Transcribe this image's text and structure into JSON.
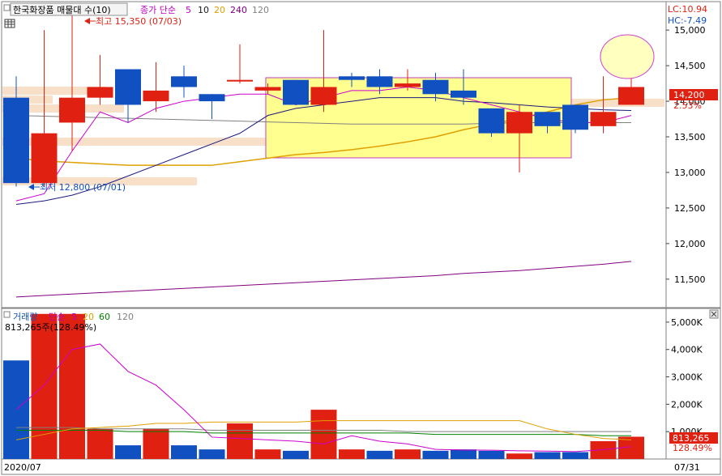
{
  "header": {
    "title": "한국화장품 매물대 수(10)",
    "ma_label": "종가 단순",
    "ma_periods": [
      "5",
      "10",
      "20",
      "240",
      "120"
    ],
    "ma_colors": [
      "#cc00cc",
      "#1a1a1a",
      "#e0a000",
      "#800080",
      "#808080"
    ],
    "lc_label": "LC:10.94",
    "hc_label": "HC:-7.49",
    "high_annot": "최고 15,350 (07/03)",
    "low_annot": "최저 12,800 (07/01)"
  },
  "volume_header": {
    "title": "거래량",
    "ma_label": "단순",
    "ma_periods": [
      "5",
      "20",
      "60",
      "120"
    ],
    "ma_colors": [
      "#cc00cc",
      "#e0a000",
      "#008000",
      "#808080"
    ],
    "readout": "813,265주(128.49%)"
  },
  "price_badge": {
    "value": "14,200",
    "pct": "2.53%"
  },
  "volume_badge": {
    "value": "813,265",
    "pct": "128.49%"
  },
  "x_axis": {
    "start_label": "2020/07",
    "end_label": "07/31"
  },
  "colors": {
    "up": "#e02010",
    "down": "#1050c0",
    "highlight": "#ffff90",
    "highlight_border": "#c040c0",
    "band": "#f8e0c8"
  },
  "chart_data": [
    {
      "type": "candlestick",
      "title": "한국화장품 매물대 수(10)",
      "ylim": [
        11100,
        15400
      ],
      "y_ticks": [
        11500,
        12000,
        12500,
        13000,
        13500,
        14000,
        14500,
        15000
      ],
      "y_tick_labels": [
        "11,500",
        "12,000",
        "12,500",
        "13,000",
        "13,500",
        "14,000",
        "14,500",
        "15,000"
      ],
      "candles": [
        {
          "o": 14050,
          "h": 14350,
          "l": 12800,
          "c": 12850
        },
        {
          "o": 12850,
          "h": 15000,
          "l": 12800,
          "c": 13550
        },
        {
          "o": 13700,
          "h": 15350,
          "l": 13300,
          "c": 14050
        },
        {
          "o": 14050,
          "h": 14650,
          "l": 13950,
          "c": 14200
        },
        {
          "o": 14450,
          "h": 14450,
          "l": 13700,
          "c": 13950
        },
        {
          "o": 14000,
          "h": 14550,
          "l": 13850,
          "c": 14150
        },
        {
          "o": 14350,
          "h": 14500,
          "l": 14050,
          "c": 14200
        },
        {
          "o": 14100,
          "h": 14100,
          "l": 13750,
          "c": 14000
        },
        {
          "o": 14300,
          "h": 14800,
          "l": 14250,
          "c": 14300
        },
        {
          "o": 14150,
          "h": 14250,
          "l": 14100,
          "c": 14200
        },
        {
          "o": 14300,
          "h": 14300,
          "l": 13950,
          "c": 13950
        },
        {
          "o": 13950,
          "h": 15000,
          "l": 13850,
          "c": 14200
        },
        {
          "o": 14350,
          "h": 14400,
          "l": 14200,
          "c": 14300
        },
        {
          "o": 14350,
          "h": 14450,
          "l": 14100,
          "c": 14200
        },
        {
          "o": 14200,
          "h": 14450,
          "l": 14150,
          "c": 14250
        },
        {
          "o": 14300,
          "h": 14400,
          "l": 14000,
          "c": 14100
        },
        {
          "o": 14150,
          "h": 14450,
          "l": 13950,
          "c": 14050
        },
        {
          "o": 13900,
          "h": 13900,
          "l": 13500,
          "c": 13550
        },
        {
          "o": 13550,
          "h": 13950,
          "l": 13000,
          "c": 13850
        },
        {
          "o": 13850,
          "h": 13850,
          "l": 13550,
          "c": 13650
        },
        {
          "o": 13950,
          "h": 13950,
          "l": 13550,
          "c": 13600
        },
        {
          "o": 13650,
          "h": 14350,
          "l": 13550,
          "c": 13850
        },
        {
          "o": 13950,
          "h": 14700,
          "l": 13950,
          "c": 14200
        }
      ],
      "ma5": [
        12600,
        12700,
        13300,
        13850,
        13700,
        13900,
        14000,
        14050,
        14100,
        14100,
        13950,
        14050,
        14150,
        14150,
        14200,
        14150,
        14050,
        13950,
        13850,
        13750,
        13700,
        13700,
        13800
      ],
      "ma10": [
        12550,
        12600,
        12680,
        12800,
        12950,
        13100,
        13250,
        13400,
        13550,
        13800,
        13900,
        13950,
        14000,
        14050,
        14050,
        14050,
        14000,
        13980,
        13950,
        13920,
        13900,
        13880,
        13870
      ],
      "ma20": [
        13200,
        13160,
        13140,
        13120,
        13100,
        13100,
        13100,
        13100,
        13150,
        13200,
        13250,
        13280,
        13320,
        13370,
        13430,
        13500,
        13600,
        13680,
        13760,
        13850,
        13950,
        14020,
        14050
      ],
      "ma240": [
        11250,
        11270,
        11290,
        11310,
        11330,
        11350,
        11370,
        11390,
        11410,
        11430,
        11450,
        11470,
        11490,
        11510,
        11530,
        11550,
        11580,
        11600,
        11620,
        11650,
        11680,
        11710,
        11750
      ],
      "ma120": [
        13800,
        13790,
        13780,
        13770,
        13760,
        13750,
        13740,
        13730,
        13720,
        13710,
        13700,
        13690,
        13680,
        13680,
        13680,
        13680,
        13680,
        13690,
        13700,
        13700,
        13700,
        13700,
        13700
      ]
    },
    {
      "type": "bar",
      "title": "거래량",
      "ylim": [
        0,
        5500000
      ],
      "y_ticks": [
        1000000,
        2000000,
        3000000,
        4000000,
        5000000
      ],
      "y_tick_labels": [
        "1,000K",
        "2,000K",
        "3,000K",
        "4,000K",
        "5,000K"
      ],
      "values": [
        3600000,
        5300000,
        5300000,
        1100000,
        500000,
        1100000,
        500000,
        350000,
        1300000,
        350000,
        300000,
        1800000,
        350000,
        300000,
        350000,
        300000,
        350000,
        300000,
        200000,
        250000,
        250000,
        650000,
        813265
      ],
      "colors": [
        "down",
        "up",
        "up",
        "up",
        "down",
        "up",
        "down",
        "down",
        "up",
        "up",
        "down",
        "up",
        "up",
        "down",
        "up",
        "down",
        "down",
        "down",
        "up",
        "down",
        "down",
        "up",
        "up"
      ],
      "ma5": [
        1800000,
        2700000,
        4000000,
        4200000,
        3200000,
        2700000,
        1800000,
        800000,
        750000,
        700000,
        650000,
        550000,
        850000,
        650000,
        550000,
        350000,
        330000,
        320000,
        300000,
        290000,
        270000,
        340000,
        450000
      ],
      "ma20": [
        700000,
        900000,
        1100000,
        1150000,
        1200000,
        1300000,
        1300000,
        1350000,
        1350000,
        1350000,
        1350000,
        1400000,
        1400000,
        1400000,
        1400000,
        1400000,
        1400000,
        1400000,
        1400000,
        1100000,
        900000,
        750000,
        700000
      ],
      "ma60": [
        1050000,
        1050000,
        1050000,
        1050000,
        1000000,
        1000000,
        1000000,
        950000,
        950000,
        950000,
        950000,
        950000,
        950000,
        950000,
        950000,
        900000,
        900000,
        900000,
        900000,
        900000,
        900000,
        850000,
        850000
      ],
      "ma120": [
        1150000,
        1150000,
        1150000,
        1100000,
        1100000,
        1100000,
        1100000,
        1050000,
        1050000,
        1050000,
        1050000,
        1050000,
        1050000,
        1050000,
        1000000,
        1000000,
        1000000,
        1000000,
        1000000,
        1000000,
        1000000,
        1000000,
        1000000
      ]
    }
  ]
}
